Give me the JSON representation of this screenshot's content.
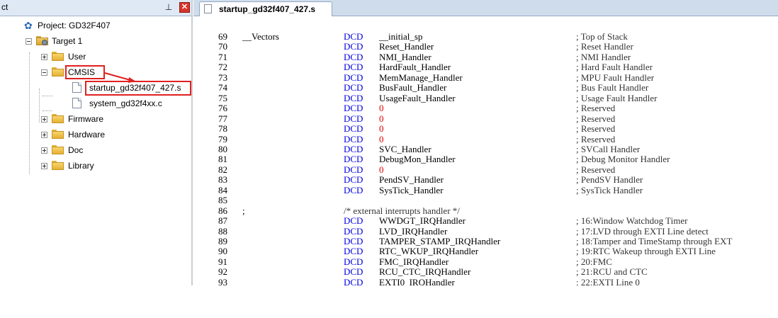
{
  "window": {
    "pane_title": "ct"
  },
  "icons": {
    "pin": "pin-icon",
    "close": "close-icon"
  },
  "project_tree": {
    "project_label": "Project: GD32F407",
    "target_label": "Target 1",
    "groups": {
      "user": "User",
      "cmsis": "CMSIS",
      "firmware": "Firmware",
      "hardware": "Hardware",
      "doc": "Doc",
      "library": "Library"
    },
    "files": {
      "startup": "startup_gd32f407_427.s",
      "system": "system_gd32f4xx.c"
    }
  },
  "editor": {
    "tab_label": "startup_gd32f407_427.s",
    "lines": [
      {
        "n": "69",
        "label": "__Vectors",
        "dir": "DCD",
        "arg": "__initial_sp",
        "cmt": "; Top of Stack"
      },
      {
        "n": "70",
        "dir": "DCD",
        "arg": "Reset_Handler",
        "cmt": "; Reset Handler"
      },
      {
        "n": "71",
        "dir": "DCD",
        "arg": "NMI_Handler",
        "cmt": "; NMI Handler"
      },
      {
        "n": "72",
        "dir": "DCD",
        "arg": "HardFault_Handler",
        "cmt": "; Hard Fault Handler"
      },
      {
        "n": "73",
        "dir": "DCD",
        "arg": "MemManage_Handler",
        "cmt": "; MPU Fault Handler"
      },
      {
        "n": "74",
        "dir": "DCD",
        "arg": "BusFault_Handler",
        "cmt": "; Bus Fault Handler"
      },
      {
        "n": "75",
        "dir": "DCD",
        "arg": "UsageFault_Handler",
        "cmt": "; Usage Fault Handler"
      },
      {
        "n": "76",
        "dir": "DCD",
        "arg": "0",
        "num": true,
        "cmt": "; Reserved"
      },
      {
        "n": "77",
        "dir": "DCD",
        "arg": "0",
        "num": true,
        "cmt": "; Reserved"
      },
      {
        "n": "78",
        "dir": "DCD",
        "arg": "0",
        "num": true,
        "cmt": "; Reserved"
      },
      {
        "n": "79",
        "dir": "DCD",
        "arg": "0",
        "num": true,
        "cmt": "; Reserved"
      },
      {
        "n": "80",
        "dir": "DCD",
        "arg": "SVC_Handler",
        "cmt": "; SVCall Handler"
      },
      {
        "n": "81",
        "dir": "DCD",
        "arg": "DebugMon_Handler",
        "cmt": "; Debug Monitor Handler"
      },
      {
        "n": "82",
        "dir": "DCD",
        "arg": "0",
        "num": true,
        "cmt": "; Reserved"
      },
      {
        "n": "83",
        "dir": "DCD",
        "arg": "PendSV_Handler",
        "cmt": "; PendSV Handler"
      },
      {
        "n": "84",
        "dir": "DCD",
        "arg": "SysTick_Handler",
        "cmt": "; SysTick Handler"
      },
      {
        "n": "85"
      },
      {
        "n": "86",
        "label": ";",
        "block": "/* external interrupts handler */"
      },
      {
        "n": "87",
        "dir": "DCD",
        "arg": "WWDGT_IRQHandler",
        "cmt": "; 16:Window Watchdog Timer"
      },
      {
        "n": "88",
        "dir": "DCD",
        "arg": "LVD_IRQHandler",
        "cmt": "; 17:LVD through EXTI Line detect"
      },
      {
        "n": "89",
        "dir": "DCD",
        "arg": "TAMPER_STAMP_IRQHandler",
        "cmt": "; 18:Tamper and TimeStamp through EXT"
      },
      {
        "n": "90",
        "dir": "DCD",
        "arg": "RTC_WKUP_IRQHandler",
        "cmt": "; 19:RTC Wakeup through EXTI Line"
      },
      {
        "n": "91",
        "dir": "DCD",
        "arg": "FMC_IRQHandler",
        "cmt": "; 20:FMC"
      },
      {
        "n": "92",
        "dir": "DCD",
        "arg": "RCU_CTC_IRQHandler",
        "cmt": "; 21:RCU and CTC"
      },
      {
        "n": "93",
        "dir": "DCD",
        "arg": "EXTI0_IRQHandler",
        "cmt": "; 22:EXTI Line 0"
      }
    ]
  },
  "colors": {
    "directive": "#0000e0",
    "number": "#e00000",
    "highlight": "#e02020"
  }
}
